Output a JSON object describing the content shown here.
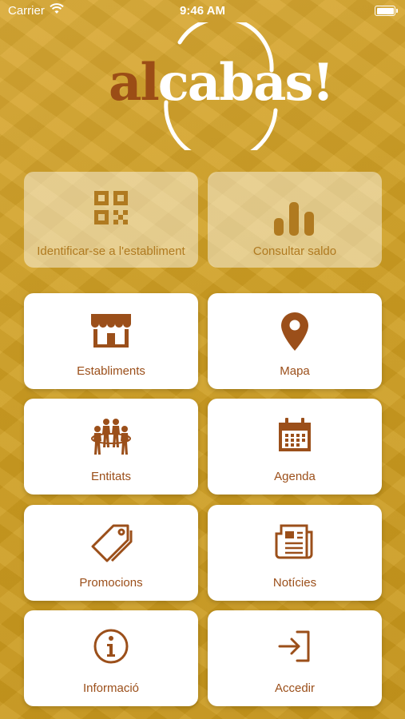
{
  "status_bar": {
    "carrier": "Carrier",
    "time": "9:46 AM"
  },
  "logo": {
    "part1": "al",
    "part2": "cabas!"
  },
  "colors": {
    "brand_brown": "#9b4f1a",
    "background_gold": "#cf9f22",
    "tile_bg": "#ffffff"
  },
  "tiles": [
    {
      "label": "Identificar-se a l'establiment",
      "icon": "qr-code-icon",
      "enabled": false
    },
    {
      "label": "Consultar saldo",
      "icon": "bar-chart-icon",
      "enabled": false
    },
    {
      "label": "Establiments",
      "icon": "storefront-icon",
      "enabled": true
    },
    {
      "label": "Mapa",
      "icon": "map-pin-icon",
      "enabled": true
    },
    {
      "label": "Entitats",
      "icon": "community-icon",
      "enabled": true
    },
    {
      "label": "Agenda",
      "icon": "calendar-icon",
      "enabled": true
    },
    {
      "label": "Promocions",
      "icon": "tag-icon",
      "enabled": true
    },
    {
      "label": "Notícies",
      "icon": "newspaper-icon",
      "enabled": true
    },
    {
      "label": "Informació",
      "icon": "info-icon",
      "enabled": true
    },
    {
      "label": "Accedir",
      "icon": "login-icon",
      "enabled": true
    }
  ]
}
